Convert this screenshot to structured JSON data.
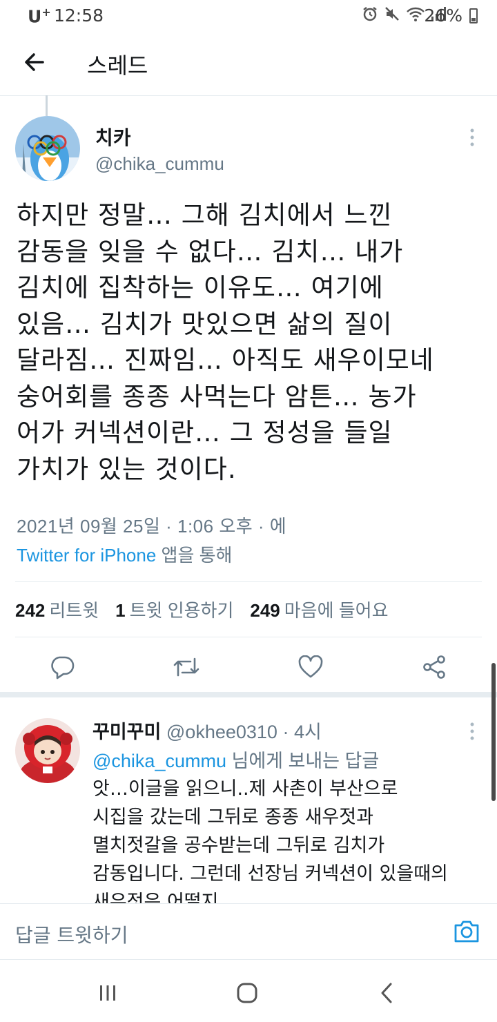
{
  "status_bar": {
    "carrier": "U",
    "carrier_plus": "+",
    "time": "12:58",
    "battery": "26%",
    "icons": [
      "alarm-icon",
      "mute-icon",
      "wifi-icon",
      "signal-icon",
      "battery-icon"
    ]
  },
  "header": {
    "title": "스레드",
    "back_icon": "back-arrow-icon"
  },
  "main_tweet": {
    "name": "치카",
    "handle": "@chika_cummu",
    "text": "하지만 정말… 그해 김치에서 느낀\n감동을 잊을 수 없다… 김치… 내가\n김치에 집착하는 이유도… 여기에\n있음… 김치가 맛있으면 삶의 질이\n달라짐… 진짜임… 아직도 새우이모네\n숭어회를 종종 사먹는다 암튼… 농가\n어가 커넥션이란… 그 정성을 들일\n가치가 있는 것이다.",
    "meta": "2021년 09월 25일 · 1:06 오후 · 에",
    "source_link": "Twitter for iPhone",
    "source_suffix": " 앱을 통해",
    "stats": {
      "retweets_count": "242",
      "retweets_label": "리트윗",
      "quotes_count": "1",
      "quotes_label": "트윗 인용하기",
      "likes_count": "249",
      "likes_label": "마음에 들어요"
    },
    "actions": [
      "reply-icon",
      "retweet-icon",
      "like-icon",
      "share-icon"
    ]
  },
  "reply_tweet": {
    "name": "꾸미꾸미",
    "handle": "@okhee0310",
    "separator": " · ",
    "time": "4시",
    "mention": "@chika_cummu",
    "replying_suffix": " 님에게 보내는 답글",
    "text": "앗…이글을 읽으니..제 사촌이 부산으로\n시집을 갔는데 그뒤로 종종 새우젓과\n멸치젓갈을 공수받는데 그뒤로 김치가\n감동입니다. 그런데 선장님 커넥션이 있을때의\n새우젓은 어떨지"
  },
  "compose": {
    "placeholder": "답글 트윗하기",
    "camera_icon": "camera-icon"
  },
  "nav_bar": {
    "buttons": [
      "recents-icon",
      "home-icon",
      "back-icon"
    ]
  },
  "colors": {
    "accent": "#1b95e0",
    "secondary_text": "#657786",
    "primary_text": "#14171a",
    "divider": "#e6ecf0"
  }
}
